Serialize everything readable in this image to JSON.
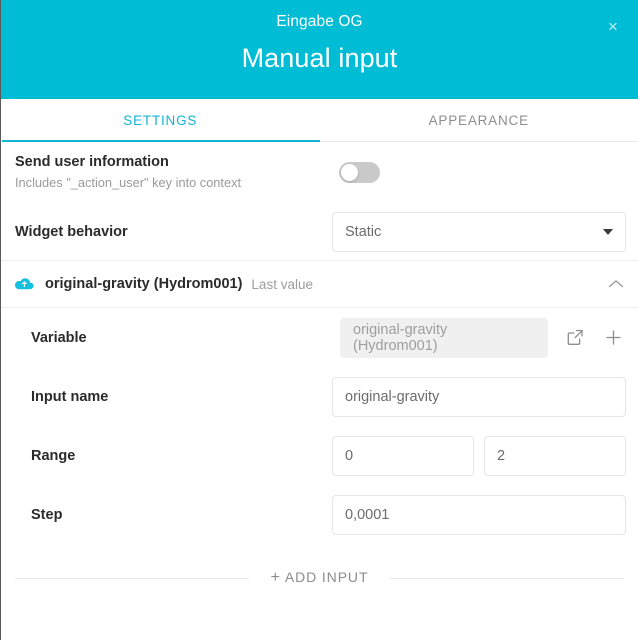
{
  "header": {
    "subtitle": "Eingabe OG",
    "title": "Manual input",
    "close_label": "×",
    "background_color": "#00bcd4"
  },
  "tabs": [
    {
      "label": "SETTINGS",
      "active": true
    },
    {
      "label": "APPEARANCE",
      "active": false
    }
  ],
  "settings": {
    "send_user_information": {
      "title": "Send user information",
      "subtitle": "Includes \"_action_user\" key into context",
      "toggle_state": "off"
    },
    "widget_behavior": {
      "label": "Widget behavior",
      "value": "Static"
    },
    "input_group": {
      "title": "original-gravity (Hydrom001)",
      "meta": "Last value",
      "expanded": true,
      "fields": {
        "variable": {
          "label": "Variable",
          "value": "original-gravity (Hydrom001)"
        },
        "input_name": {
          "label": "Input name",
          "value": "original-gravity"
        },
        "range": {
          "label": "Range",
          "min": "0",
          "max": "2"
        },
        "step": {
          "label": "Step",
          "value": "0,0001"
        }
      }
    },
    "add_input": {
      "plus": "+",
      "label": "ADD INPUT"
    }
  },
  "colors": {
    "accent": "#00bcd4",
    "tab_active": "#13b4d4",
    "text_primary": "#2b2b2b",
    "text_muted": "#9a9a9a"
  }
}
